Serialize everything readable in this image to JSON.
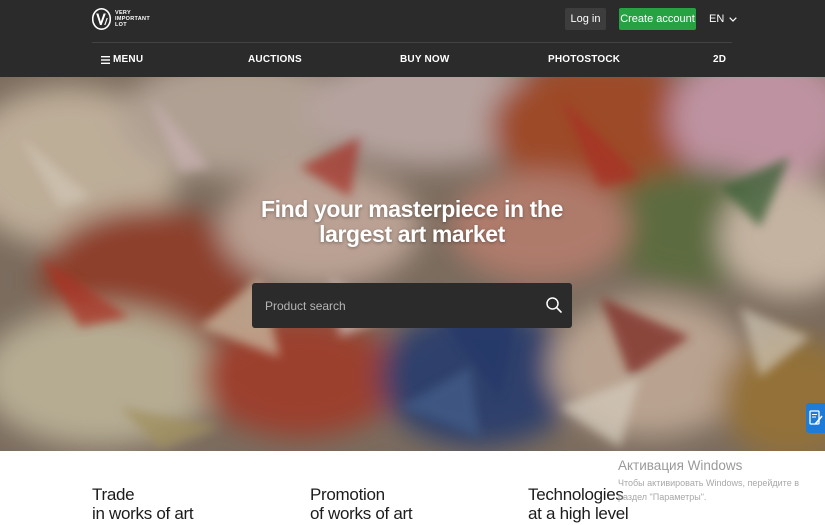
{
  "header": {
    "logo_lines": [
      "VERY",
      "IMPORTANT",
      "LOT"
    ],
    "login_label": "Log in",
    "create_account_label": "Create account",
    "language": "EN",
    "colors": {
      "bar": "#2b2b2b",
      "create_account": "#27a243"
    }
  },
  "nav": {
    "menu_label": "MENU",
    "menu_icon": "hamburger-icon",
    "items": [
      {
        "label": "AUCTIONS"
      },
      {
        "label": "BUY NOW"
      },
      {
        "label": "PHOTOSTOCK"
      },
      {
        "label": "2D"
      }
    ]
  },
  "hero": {
    "title": "Find your masterpiece in the largest art market",
    "search": {
      "placeholder": "Product search",
      "value": "",
      "icon": "search-icon"
    }
  },
  "features": [
    {
      "line1": "Trade",
      "line2": "in works of art"
    },
    {
      "line1": "Promotion",
      "line2": "of works of art"
    },
    {
      "line1": "Technologies",
      "line2": "at a high level"
    }
  ],
  "windows_watermark": {
    "title": "Активация Windows",
    "text": "Чтобы активировать Windows, перейдите в раздел \"Параметры\"."
  },
  "side_badge": {
    "icon": "edit-note-icon",
    "color": "#1e7bd8"
  }
}
